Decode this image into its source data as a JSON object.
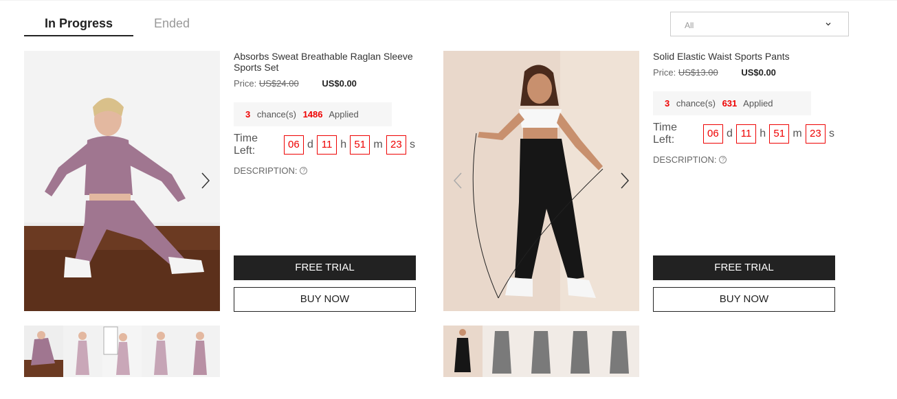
{
  "tabs": [
    {
      "label": "In Progress",
      "active": true
    },
    {
      "label": "Ended",
      "active": false
    }
  ],
  "filter": {
    "selected": "All",
    "icon": "chevron-down-icon"
  },
  "products": [
    {
      "title": "Absorbs Sweat Breathable Raglan Sleeve Sports Set",
      "price_label": "Price:",
      "old_price": "US$24.00",
      "new_price": "US$0.00",
      "chances": "3",
      "chances_label": "chance(s)",
      "applied": "1486",
      "applied_label": "Applied",
      "time_left_label": "Time Left:",
      "days": "06",
      "hours": "11",
      "minutes": "51",
      "seconds": "23",
      "unit_d": "d",
      "unit_h": "h",
      "unit_m": "m",
      "unit_s": "s",
      "description_label": "DESCRIPTION:",
      "free_trial_label": "FREE TRIAL",
      "buy_now_label": "BUY NOW",
      "image_colors": {
        "garment": "#a07690",
        "background": "#ececec",
        "floor": "#6b3a22"
      }
    },
    {
      "title": "Solid Elastic Waist Sports Pants",
      "price_label": "Price:",
      "old_price": "US$13.00",
      "new_price": "US$0.00",
      "chances": "3",
      "chances_label": "chance(s)",
      "applied": "631",
      "applied_label": "Applied",
      "time_left_label": "Time Left:",
      "days": "06",
      "hours": "11",
      "minutes": "51",
      "seconds": "23",
      "unit_d": "d",
      "unit_h": "h",
      "unit_m": "m",
      "unit_s": "s",
      "description_label": "DESCRIPTION:",
      "free_trial_label": "FREE TRIAL",
      "buy_now_label": "BUY NOW",
      "image_colors": {
        "garment": "#161616",
        "background": "#e9d8cb",
        "thumb_alt": "#7a7a7a"
      }
    }
  ],
  "colors": {
    "accent_red": "#e00000",
    "button_dark": "#222222"
  }
}
